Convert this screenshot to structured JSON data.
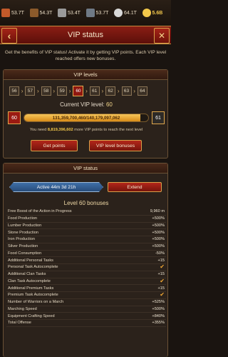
{
  "resources": [
    {
      "icon": "food-icon",
      "value": "53.7T",
      "color": "#c45a2a"
    },
    {
      "icon": "lumber-icon",
      "value": "54.3T",
      "color": "#8b5a2b"
    },
    {
      "icon": "stone-icon",
      "value": "53.4T",
      "color": "#9a9a9a"
    },
    {
      "icon": "iron-icon",
      "value": "53.7T",
      "color": "#6f7a86"
    },
    {
      "icon": "silver-icon",
      "value": "64.1T",
      "color": "#d8d8d8"
    },
    {
      "icon": "gold-icon",
      "value": "5.6B",
      "color": "#f3c84a"
    }
  ],
  "header": {
    "title": "VIP status",
    "back_icon": "chevron-left-icon",
    "close_icon": "close-icon"
  },
  "description": "Get the benefits of VIP status! Activate it by getting VIP points. Each VIP level reached offers new bonuses.",
  "levels_panel": {
    "heading": "VIP levels",
    "levels": [
      "56",
      "57",
      "58",
      "59",
      "60",
      "61",
      "62",
      "63",
      "64"
    ],
    "current_index": 4,
    "current_label": "Current VIP level:",
    "current_value": "60",
    "from_level": "60",
    "to_level": "61",
    "progress_text": "131,359,700,460/140,179,097,062",
    "progress_fraction": 0.937,
    "need_prefix": "You need",
    "need_amount": "8,819,396,602",
    "need_suffix": "more VIP points to reach the next level",
    "get_points_label": "Get points",
    "bonuses_label": "VIP level bonuses"
  },
  "status_panel": {
    "heading": "VIP status",
    "active_text": "Active 44m 3d 21h",
    "extend_label": "Extend",
    "bonus_title": "Level 60 bonuses",
    "bonuses": [
      {
        "name": "Free Boost of the Action in Progress",
        "value": "9,960 m"
      },
      {
        "name": "Food Production",
        "value": "+500%"
      },
      {
        "name": "Lumber Production",
        "value": "+500%"
      },
      {
        "name": "Stone Production",
        "value": "+500%"
      },
      {
        "name": "Iron Production",
        "value": "+500%"
      },
      {
        "name": "Silver Production",
        "value": "+500%"
      },
      {
        "name": "Food Consumption",
        "value": "-50%"
      },
      {
        "name": "Additional Personal Tasks",
        "value": "+15"
      },
      {
        "name": "Personal Task Autocomplete",
        "value": "✔"
      },
      {
        "name": "Additional Clan Tasks",
        "value": "+15"
      },
      {
        "name": "Clan Task Autocomplete",
        "value": "✔"
      },
      {
        "name": "Additional Premium Tasks",
        "value": "+15"
      },
      {
        "name": "Premium Task Autocomplete",
        "value": "✔"
      },
      {
        "name": "Number of Warriors on a March",
        "value": "+525%"
      },
      {
        "name": "Marching Speed",
        "value": "+500%"
      },
      {
        "name": "Equipment Crafting Speed",
        "value": "+840%"
      },
      {
        "name": "Total Offense",
        "value": "+355%"
      }
    ]
  }
}
